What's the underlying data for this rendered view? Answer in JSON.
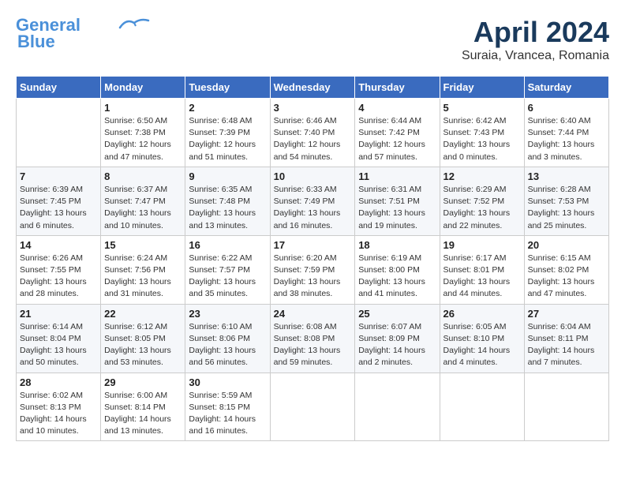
{
  "header": {
    "logo_line1": "General",
    "logo_line2": "Blue",
    "month_title": "April 2024",
    "subtitle": "Suraia, Vrancea, Romania"
  },
  "weekdays": [
    "Sunday",
    "Monday",
    "Tuesday",
    "Wednesday",
    "Thursday",
    "Friday",
    "Saturday"
  ],
  "weeks": [
    [
      {
        "day": "",
        "info": ""
      },
      {
        "day": "1",
        "info": "Sunrise: 6:50 AM\nSunset: 7:38 PM\nDaylight: 12 hours\nand 47 minutes."
      },
      {
        "day": "2",
        "info": "Sunrise: 6:48 AM\nSunset: 7:39 PM\nDaylight: 12 hours\nand 51 minutes."
      },
      {
        "day": "3",
        "info": "Sunrise: 6:46 AM\nSunset: 7:40 PM\nDaylight: 12 hours\nand 54 minutes."
      },
      {
        "day": "4",
        "info": "Sunrise: 6:44 AM\nSunset: 7:42 PM\nDaylight: 12 hours\nand 57 minutes."
      },
      {
        "day": "5",
        "info": "Sunrise: 6:42 AM\nSunset: 7:43 PM\nDaylight: 13 hours\nand 0 minutes."
      },
      {
        "day": "6",
        "info": "Sunrise: 6:40 AM\nSunset: 7:44 PM\nDaylight: 13 hours\nand 3 minutes."
      }
    ],
    [
      {
        "day": "7",
        "info": "Sunrise: 6:39 AM\nSunset: 7:45 PM\nDaylight: 13 hours\nand 6 minutes."
      },
      {
        "day": "8",
        "info": "Sunrise: 6:37 AM\nSunset: 7:47 PM\nDaylight: 13 hours\nand 10 minutes."
      },
      {
        "day": "9",
        "info": "Sunrise: 6:35 AM\nSunset: 7:48 PM\nDaylight: 13 hours\nand 13 minutes."
      },
      {
        "day": "10",
        "info": "Sunrise: 6:33 AM\nSunset: 7:49 PM\nDaylight: 13 hours\nand 16 minutes."
      },
      {
        "day": "11",
        "info": "Sunrise: 6:31 AM\nSunset: 7:51 PM\nDaylight: 13 hours\nand 19 minutes."
      },
      {
        "day": "12",
        "info": "Sunrise: 6:29 AM\nSunset: 7:52 PM\nDaylight: 13 hours\nand 22 minutes."
      },
      {
        "day": "13",
        "info": "Sunrise: 6:28 AM\nSunset: 7:53 PM\nDaylight: 13 hours\nand 25 minutes."
      }
    ],
    [
      {
        "day": "14",
        "info": "Sunrise: 6:26 AM\nSunset: 7:55 PM\nDaylight: 13 hours\nand 28 minutes."
      },
      {
        "day": "15",
        "info": "Sunrise: 6:24 AM\nSunset: 7:56 PM\nDaylight: 13 hours\nand 31 minutes."
      },
      {
        "day": "16",
        "info": "Sunrise: 6:22 AM\nSunset: 7:57 PM\nDaylight: 13 hours\nand 35 minutes."
      },
      {
        "day": "17",
        "info": "Sunrise: 6:20 AM\nSunset: 7:59 PM\nDaylight: 13 hours\nand 38 minutes."
      },
      {
        "day": "18",
        "info": "Sunrise: 6:19 AM\nSunset: 8:00 PM\nDaylight: 13 hours\nand 41 minutes."
      },
      {
        "day": "19",
        "info": "Sunrise: 6:17 AM\nSunset: 8:01 PM\nDaylight: 13 hours\nand 44 minutes."
      },
      {
        "day": "20",
        "info": "Sunrise: 6:15 AM\nSunset: 8:02 PM\nDaylight: 13 hours\nand 47 minutes."
      }
    ],
    [
      {
        "day": "21",
        "info": "Sunrise: 6:14 AM\nSunset: 8:04 PM\nDaylight: 13 hours\nand 50 minutes."
      },
      {
        "day": "22",
        "info": "Sunrise: 6:12 AM\nSunset: 8:05 PM\nDaylight: 13 hours\nand 53 minutes."
      },
      {
        "day": "23",
        "info": "Sunrise: 6:10 AM\nSunset: 8:06 PM\nDaylight: 13 hours\nand 56 minutes."
      },
      {
        "day": "24",
        "info": "Sunrise: 6:08 AM\nSunset: 8:08 PM\nDaylight: 13 hours\nand 59 minutes."
      },
      {
        "day": "25",
        "info": "Sunrise: 6:07 AM\nSunset: 8:09 PM\nDaylight: 14 hours\nand 2 minutes."
      },
      {
        "day": "26",
        "info": "Sunrise: 6:05 AM\nSunset: 8:10 PM\nDaylight: 14 hours\nand 4 minutes."
      },
      {
        "day": "27",
        "info": "Sunrise: 6:04 AM\nSunset: 8:11 PM\nDaylight: 14 hours\nand 7 minutes."
      }
    ],
    [
      {
        "day": "28",
        "info": "Sunrise: 6:02 AM\nSunset: 8:13 PM\nDaylight: 14 hours\nand 10 minutes."
      },
      {
        "day": "29",
        "info": "Sunrise: 6:00 AM\nSunset: 8:14 PM\nDaylight: 14 hours\nand 13 minutes."
      },
      {
        "day": "30",
        "info": "Sunrise: 5:59 AM\nSunset: 8:15 PM\nDaylight: 14 hours\nand 16 minutes."
      },
      {
        "day": "",
        "info": ""
      },
      {
        "day": "",
        "info": ""
      },
      {
        "day": "",
        "info": ""
      },
      {
        "day": "",
        "info": ""
      }
    ]
  ]
}
